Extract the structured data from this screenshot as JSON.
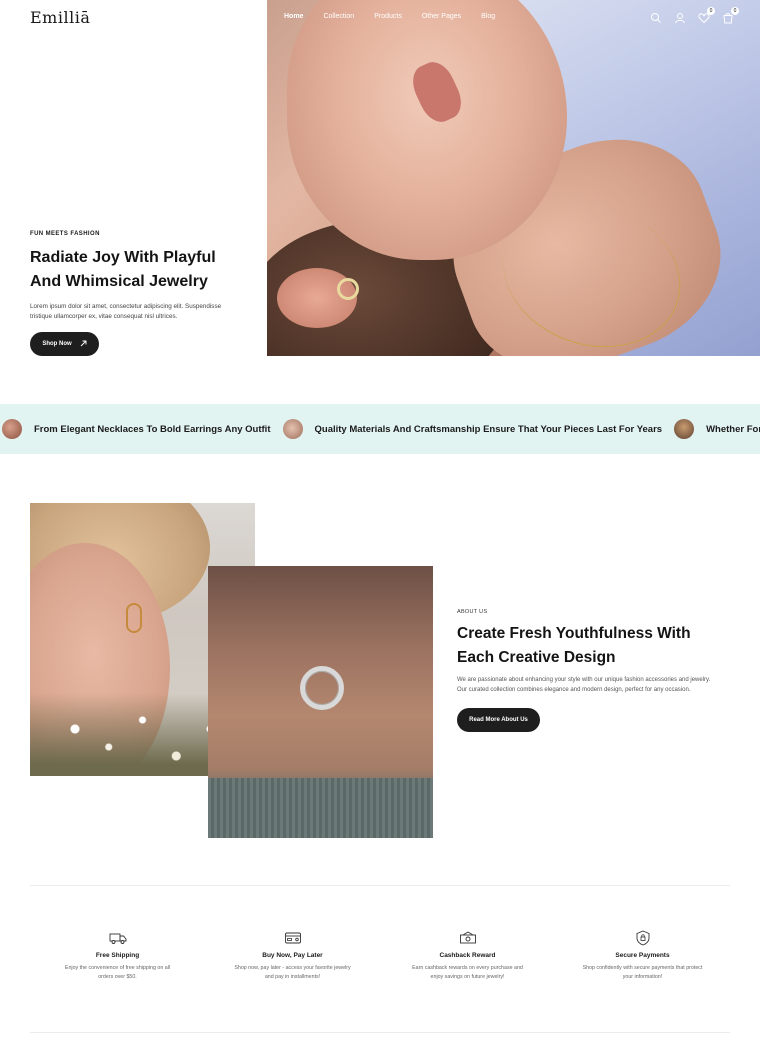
{
  "brand": {
    "logo": "Emilliā"
  },
  "nav": {
    "items": [
      {
        "label": "Home",
        "active": true
      },
      {
        "label": "Collection",
        "active": false
      },
      {
        "label": "Products",
        "active": false
      },
      {
        "label": "Other Pages",
        "active": false
      },
      {
        "label": "Blog",
        "active": false
      }
    ],
    "wishlist_count": "0",
    "cart_count": "0",
    "icons": [
      "search-icon",
      "user-icon",
      "wishlist-icon",
      "cart-icon"
    ]
  },
  "hero": {
    "eyebrow": "FUN MEETS FASHION",
    "title": "Radiate Joy With Playful And Whimsical Jewelry",
    "body": "Lorem ipsum dolor sit amet, consectetur adipiscing elit. Suspendisse tristique ullamcorper ex, vitae consequat nisl ultrices.",
    "cta": "Shop Now",
    "cta_icon": "arrow-up-right-icon"
  },
  "marquee": {
    "background": "#e2f4f1",
    "items": [
      "From Elegant Necklaces To Bold Earrings Any Outfit",
      "Quality Materials And Craftsmanship Ensure That Your Pieces Last For Years",
      "Whether For Everyday We"
    ]
  },
  "about": {
    "eyebrow": "ABOUT US",
    "title": "Create Fresh Youthfulness With Each Creative Design",
    "body": "We are passionate about enhancing your style with our unique fashion accessories and jewelry. Our curated collection combines elegance and modern design, perfect for any occasion.",
    "cta": "Read More About Us"
  },
  "features": [
    {
      "icon": "truck-icon",
      "title": "Free Shipping",
      "body": "Enjoy the convenience of free shipping on all orders over $50."
    },
    {
      "icon": "credit-card-icon",
      "title": "Buy Now, Pay Later",
      "body": "Shop now, pay later - access your favorite jewelry and pay in installments!"
    },
    {
      "icon": "cashback-icon",
      "title": "Cashback Reward",
      "body": "Earn cashback rewards on every purchase and enjoy savings on future jewelry!"
    },
    {
      "icon": "shield-icon",
      "title": "Secure Payments",
      "body": "Shop confidently with secure payments that protect your information!"
    }
  ],
  "colors": {
    "accent_dark": "#1e1e1e",
    "marquee_bg": "#e2f4f1",
    "text": "#1a1a1a"
  }
}
